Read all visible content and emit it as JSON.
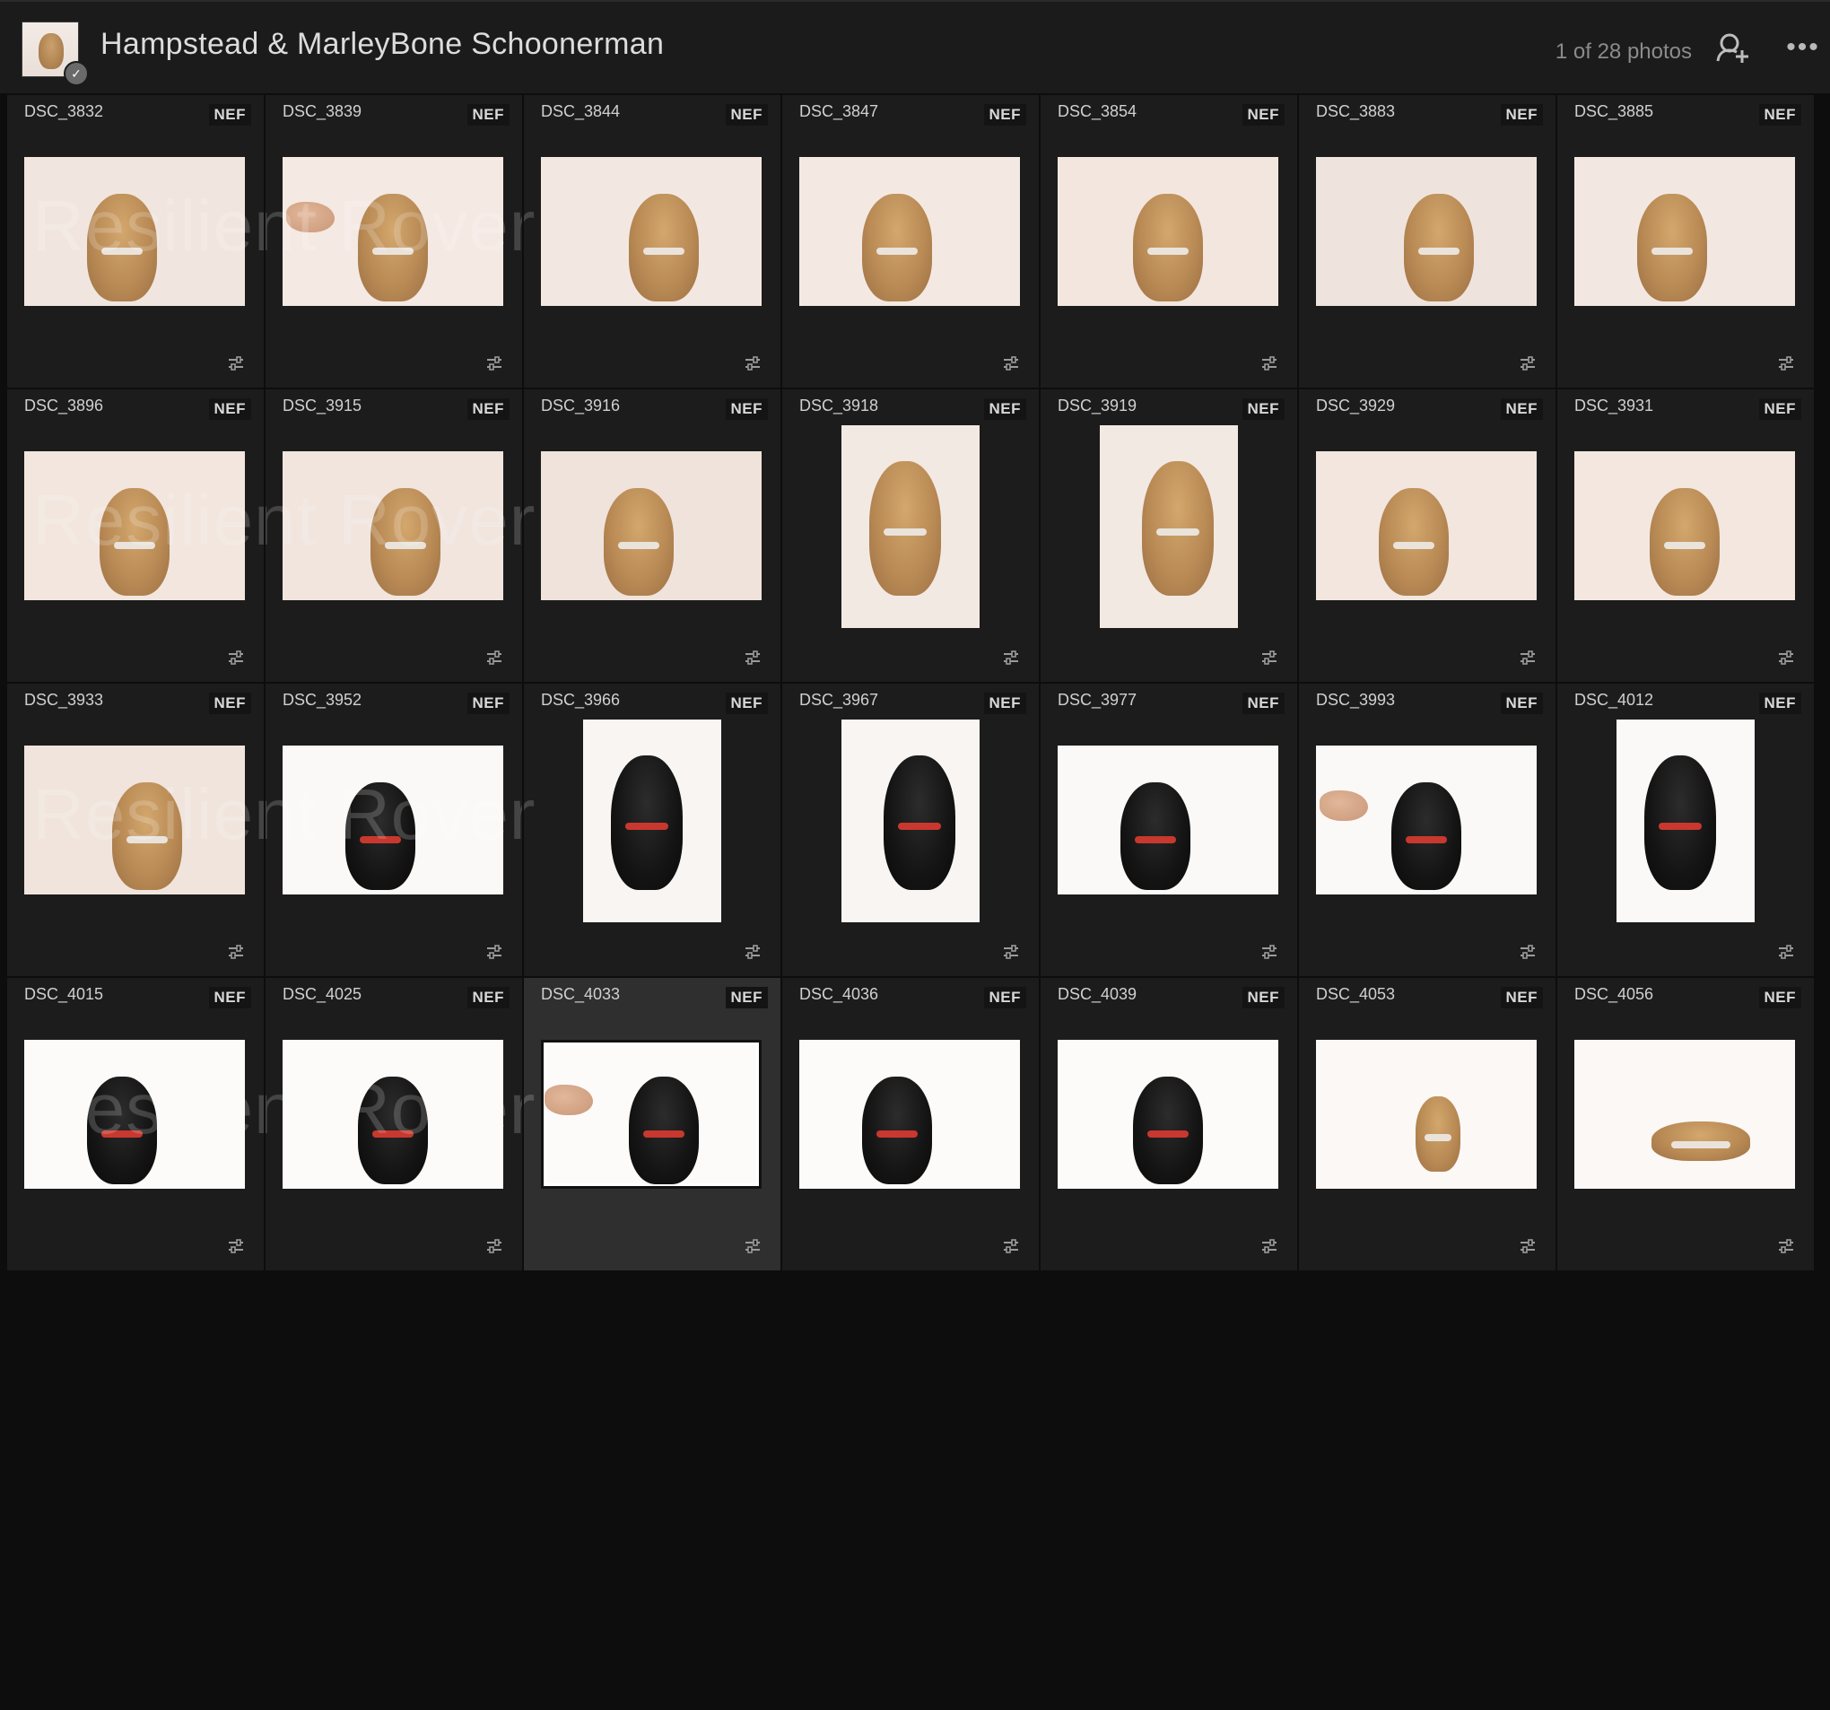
{
  "header": {
    "album_title": "Hampstead & MarleyBone Schoonerman",
    "photo_count": "1 of 28 photos",
    "more_label": "•••"
  },
  "watermark": "Resilient Rover",
  "colors": {
    "background": "#0d0d0d",
    "cell": "#1c1c1c",
    "selected_cell": "#2f2f2f"
  },
  "photos": [
    {
      "name": "DSC_3832",
      "type": "NEF",
      "orient": "landscape",
      "dog": "gold",
      "bg": "#f1e6df"
    },
    {
      "name": "DSC_3839",
      "type": "NEF",
      "orient": "landscape",
      "dog": "gold",
      "bg": "#f4e9e3",
      "hand": true
    },
    {
      "name": "DSC_3844",
      "type": "NEF",
      "orient": "landscape",
      "dog": "gold",
      "bg": "#f3e8e1"
    },
    {
      "name": "DSC_3847",
      "type": "NEF",
      "orient": "landscape",
      "dog": "gold",
      "bg": "#f4e9e2"
    },
    {
      "name": "DSC_3854",
      "type": "NEF",
      "orient": "landscape",
      "dog": "gold",
      "bg": "#f2e6df"
    },
    {
      "name": "DSC_3883",
      "type": "NEF",
      "orient": "landscape",
      "dog": "gold",
      "bg": "#efe4dd"
    },
    {
      "name": "DSC_3885",
      "type": "NEF",
      "orient": "landscape",
      "dog": "gold",
      "bg": "#f3e8e1"
    },
    {
      "name": "DSC_3896",
      "type": "NEF",
      "orient": "landscape",
      "dog": "gold",
      "bg": "#f2e6df"
    },
    {
      "name": "DSC_3915",
      "type": "NEF",
      "orient": "landscape",
      "dog": "gold",
      "bg": "#f1e5de"
    },
    {
      "name": "DSC_3916",
      "type": "NEF",
      "orient": "landscape",
      "dog": "gold",
      "bg": "#efe3dc"
    },
    {
      "name": "DSC_3918",
      "type": "NEF",
      "orient": "portrait",
      "dog": "gold",
      "bg": "#f3e9e3"
    },
    {
      "name": "DSC_3919",
      "type": "NEF",
      "orient": "portrait",
      "dog": "gold",
      "bg": "#f3e9e3"
    },
    {
      "name": "DSC_3929",
      "type": "NEF",
      "orient": "landscape",
      "dog": "gold",
      "bg": "#f2e6df"
    },
    {
      "name": "DSC_3931",
      "type": "NEF",
      "orient": "landscape",
      "dog": "gold",
      "bg": "#f3e7e0"
    },
    {
      "name": "DSC_3933",
      "type": "NEF",
      "orient": "landscape",
      "dog": "gold",
      "bg": "#f0e4dd"
    },
    {
      "name": "DSC_3952",
      "type": "NEF",
      "orient": "landscape",
      "dog": "black",
      "bg": "#fbf9f7"
    },
    {
      "name": "DSC_3966",
      "type": "NEF",
      "orient": "portrait",
      "dog": "black",
      "bg": "#f8f5f2"
    },
    {
      "name": "DSC_3967",
      "type": "NEF",
      "orient": "portrait",
      "dog": "black",
      "bg": "#f8f5f2"
    },
    {
      "name": "DSC_3977",
      "type": "NEF",
      "orient": "landscape",
      "dog": "black",
      "bg": "#fbf9f7"
    },
    {
      "name": "DSC_3993",
      "type": "NEF",
      "orient": "landscape",
      "dog": "black",
      "bg": "#fbf9f7",
      "hand": true
    },
    {
      "name": "DSC_4012",
      "type": "NEF",
      "orient": "portrait",
      "dog": "black",
      "bg": "#fbf9f7"
    },
    {
      "name": "DSC_4015",
      "type": "NEF",
      "orient": "landscape",
      "dog": "black",
      "bg": "#fcfbf9"
    },
    {
      "name": "DSC_4025",
      "type": "NEF",
      "orient": "landscape",
      "dog": "black",
      "bg": "#fcfbf9"
    },
    {
      "name": "DSC_4033",
      "type": "NEF",
      "orient": "landscape",
      "dog": "black",
      "bg": "#fcfbf9",
      "selected": true,
      "hand": true
    },
    {
      "name": "DSC_4036",
      "type": "NEF",
      "orient": "landscape",
      "dog": "black",
      "bg": "#fcfbf9"
    },
    {
      "name": "DSC_4039",
      "type": "NEF",
      "orient": "landscape",
      "dog": "black",
      "bg": "#fcfbf9"
    },
    {
      "name": "DSC_4053",
      "type": "NEF",
      "orient": "landscape",
      "dog": "gold",
      "bg": "#fbf8f6",
      "small": true
    },
    {
      "name": "DSC_4056",
      "type": "NEF",
      "orient": "landscape",
      "dog": "gold",
      "bg": "#fbf8f6",
      "small": true,
      "lying": true
    }
  ]
}
